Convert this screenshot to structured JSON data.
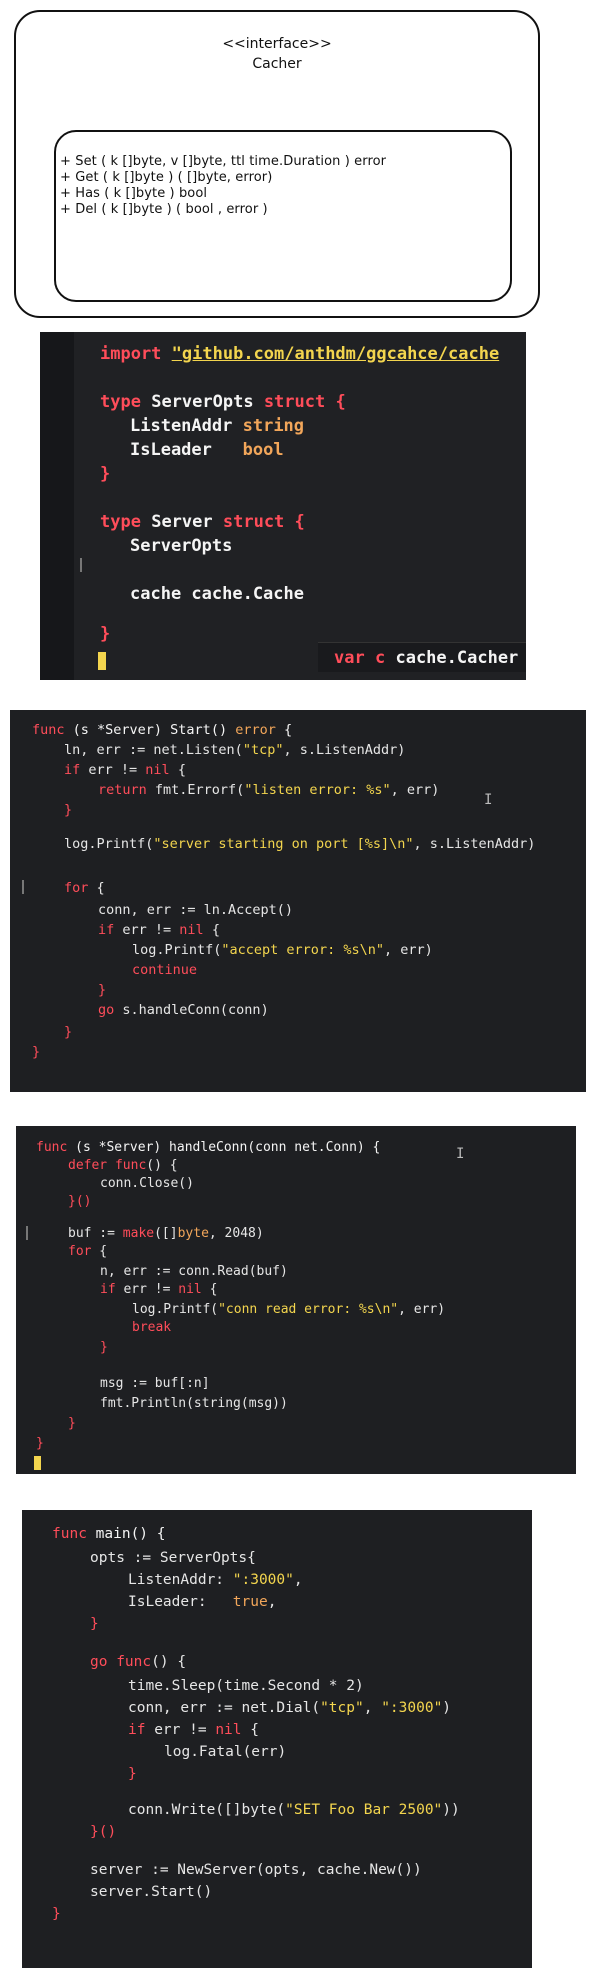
{
  "uml": {
    "stereotype": "<<interface>>",
    "name": "Cacher",
    "methods": [
      "+ Set ( k []byte, v []byte, ttl time.Duration ) error",
      "+ Get ( k []byte ) ( []byte, error)",
      "+ Has ( k []byte ) bool",
      "+ Del ( k []byte ) ( bool , error )"
    ]
  },
  "panel1": {
    "import_kw": "import",
    "import_path": "\"github.com/anthdm/ggcahce/cache",
    "s1_type": "type",
    "s1_name": "ServerOpts",
    "s1_struct": "struct",
    "s1_brace": "{",
    "f1_name": "ListenAddr",
    "f1_type": "string",
    "f2_name": "IsLeader",
    "f2_type": "bool",
    "close1": "}",
    "s2_type": "type",
    "s2_name": "Server",
    "s2_struct": "struct",
    "s2_brace": "{",
    "f3_name": "ServerOpts",
    "f4": "cache cache.Cache",
    "close2": "}",
    "hint_var": "var",
    "hint_c": "c",
    "hint_type": "cache.Cacher"
  },
  "panel2": {
    "l1_a": "func",
    "l1_b": " (s *Server) Start() ",
    "l1_c": "error",
    "l1_d": " {",
    "l2": "ln, err := net.Listen(",
    "l2_s": "\"tcp\"",
    "l2_e": ", s.ListenAddr)",
    "l3_a": "if",
    "l3_b": " err != ",
    "l3_c": "nil",
    "l3_d": " {",
    "l4_a": "return",
    "l4_b": " fmt.Errorf(",
    "l4_s": "\"listen error: %s\"",
    "l4_e": ", err)",
    "l5": "}",
    "l6_a": "log.Printf(",
    "l6_s": "\"server starting on port [%s]\\n\"",
    "l6_e": ", s.ListenAddr)",
    "l7_a": "for",
    "l7_b": " {",
    "l8": "conn, err := ln.Accept()",
    "l9_a": "if",
    "l9_b": " err != ",
    "l9_c": "nil",
    "l9_d": " {",
    "l10_a": "log.Printf(",
    "l10_s": "\"accept error: %s\\n\"",
    "l10_e": ", err)",
    "l11": "continue",
    "l12": "}",
    "l13_a": "go",
    "l13_b": " s.handleConn(conn)",
    "l14": "}",
    "l15": "}",
    "ibeam": "I"
  },
  "panel3": {
    "l1_a": "func",
    "l1_b": " (s *Server) handleConn(conn net.Conn) {",
    "l2_a": "defer",
    "l2_b": " func",
    "l2_c": "() {",
    "l3": "conn.Close()",
    "l4": "}()",
    "l5_a": "buf := ",
    "l5_b": "make",
    "l5_c": "([]",
    "l5_d": "byte",
    "l5_e": ", 2048)",
    "l6_a": "for",
    "l6_b": " {",
    "l7": "n, err := conn.Read(buf)",
    "l8_a": "if",
    "l8_b": " err != ",
    "l8_c": "nil",
    "l8_d": " {",
    "l9_a": "log.Printf(",
    "l9_s": "\"conn read error: %s\\n\"",
    "l9_e": ", err)",
    "l10": "break",
    "l11": "}",
    "l12": "msg := buf[:n]",
    "l13": "fmt.Println(string(msg))",
    "l14": "}",
    "l15": "}",
    "ibeam": "I"
  },
  "panel4": {
    "l1_a": "func",
    "l1_b": " main() {",
    "l2": "opts := ServerOpts{",
    "l3_a": "ListenAddr: ",
    "l3_s": "\":3000\"",
    "l3_e": ",",
    "l4_a": "IsLeader:   ",
    "l4_b": "true",
    "l4_e": ",",
    "l5": "}",
    "l6_a": "go",
    "l6_b": " func",
    "l6_c": "() {",
    "l7": "time.Sleep(time.Second * 2)",
    "l8_a": "conn, err := net.Dial(",
    "l8_s1": "\"tcp\"",
    "l8_m": ", ",
    "l8_s2": "\":3000\"",
    "l8_e": ")",
    "l9_a": "if",
    "l9_b": " err != ",
    "l9_c": "nil",
    "l9_d": " {",
    "l10": "log.Fatal(err)",
    "l11": "}",
    "l12_a": "conn.Write([]byte(",
    "l12_s": "\"SET Foo Bar 2500\"",
    "l12_e": "))",
    "l13": "}()",
    "l14": "server := NewServer(opts, cache.New())",
    "l15": "server.Start()",
    "l16": "}"
  },
  "colors": {
    "keyword": "#ff4d5a",
    "type": "#f2a65a",
    "string": "#f3d54e",
    "background": "#1f2023"
  }
}
